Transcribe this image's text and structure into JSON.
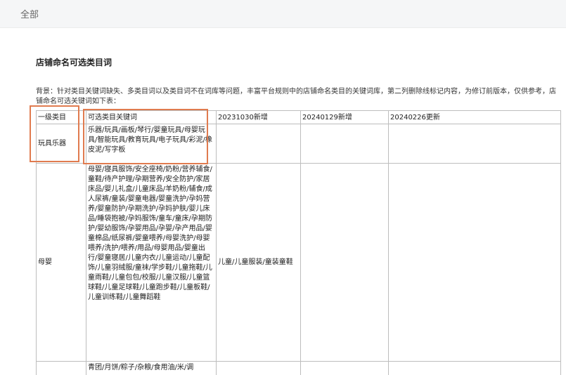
{
  "breadcrumb": {
    "label": "全部"
  },
  "document": {
    "title": "店铺命名可选类目词",
    "background": "背景：针对类目关键词缺失、多类目词以及类目词不在词库等问题，丰富平台规则中的店铺命名类目的关键词库，第二列删除线标记内容，为修订前版本，仅供参考，店铺命名可选关键词如下表："
  },
  "table": {
    "headers": [
      "一级类目",
      "可选类目关键词",
      "20231030新增",
      "20240129新增",
      "20240226更新"
    ],
    "rows": [
      {
        "category": "玩具乐器",
        "keywords": "乐器/玩具/画板/琴行/婴童玩具/母婴玩具/智能玩具/教育玩具/电子玩具/彩泥/橡皮泥/写字板",
        "add_20231030": "",
        "add_20240129": "",
        "update_20240226": ""
      },
      {
        "category": "母婴",
        "keywords": "母婴/寝具服饰/安全座椅/奶粉/营养辅食/童鞋/待产护理/孕期营养/安全防护/家居床品/婴儿礼盒/儿童床品/羊奶粉/辅食/成人尿裤/童装/婴童电器/婴童洗护/孕妈营养/婴童防护/孕期洗护/孕妈护肤/婴儿床品/睡袋抱被/孕妈服饰/童车/童床/孕期防护/婴幼服饰/孕婴用品/孕婴/孕产用品/婴童棉品/纸尿裤/婴童喂养/母婴洗护/母婴喂养/洗护/喂养/用品/母婴用品/婴童出行/婴童寝居/儿童内衣/儿童运动/儿童配饰/儿童羽绒服/童袜/学步鞋/儿童拖鞋/儿童雨鞋/儿童包包/校服/儿童汉服/儿童篮球鞋/儿童足球鞋/儿童跑步鞋/儿童板鞋/儿童训练鞋/儿童舞蹈鞋",
        "add_20231030": "儿童/儿童服装/童装童鞋",
        "add_20240129": "",
        "update_20240226": ""
      },
      {
        "category": "",
        "keywords": "青团/月饼/粽子/杂粮/食用油/米/调",
        "add_20231030": "",
        "add_20240129": "",
        "update_20240226": ""
      }
    ]
  },
  "colors": {
    "highlight": "#e07b4f",
    "topbar": "#f5f6f7",
    "grid": "#bdbdbd"
  }
}
